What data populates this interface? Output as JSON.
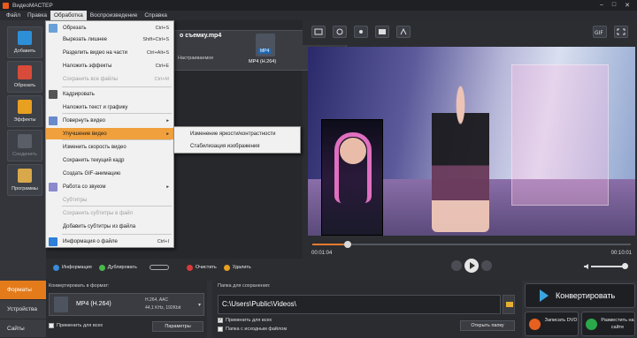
{
  "window": {
    "title": "ВидеоМАСТЕР"
  },
  "menubar": {
    "items": [
      "Файл",
      "Правка",
      "Обработка",
      "Воспроизведение",
      "Справка"
    ],
    "active": "Обработка"
  },
  "left_toolbar": {
    "add": "Добавить",
    "process": "Обрезать",
    "effects": "Эффекты",
    "merge": "Соединить",
    "programs": "Программы"
  },
  "clip": {
    "name": "о съемку.mp4",
    "resolution": "Настраиваемое",
    "format": "MP4 (H.264)",
    "close": "✕"
  },
  "dropdown": {
    "items": [
      {
        "label": "Обрезать",
        "shortcut": "Ctrl+S",
        "disabled": false
      },
      {
        "label": "Вырезать лишнее",
        "shortcut": "Shift+Ctrl+S",
        "disabled": false
      },
      {
        "label": "Разделить видео на части",
        "shortcut": "Ctrl+Alt+S",
        "disabled": false
      },
      {
        "label": "Наложить эффекты",
        "shortcut": "Ctrl+E",
        "disabled": false
      },
      {
        "label": "Сохранить все файлы",
        "shortcut": "Ctrl+M",
        "disabled": true
      },
      {
        "label": "Кадрировать",
        "shortcut": "",
        "disabled": false
      },
      {
        "label": "Наложить текст и графику",
        "shortcut": "",
        "disabled": false
      },
      {
        "label": "Повернуть видео",
        "shortcut": "▸",
        "disabled": false
      },
      {
        "label": "Улучшение видео",
        "shortcut": "▸",
        "disabled": false
      },
      {
        "label": "Изменить скорость видео",
        "shortcut": "",
        "disabled": false
      },
      {
        "label": "Сохранить текущий кадр",
        "shortcut": "",
        "disabled": false
      },
      {
        "label": "Создать GIF-анимацию",
        "shortcut": "",
        "disabled": false
      },
      {
        "label": "Работа со звуком",
        "shortcut": "▸",
        "disabled": false
      },
      {
        "label": "Субтитры",
        "shortcut": "",
        "disabled": true
      },
      {
        "label": "Сохранить субтитры в файл",
        "shortcut": "",
        "disabled": true
      },
      {
        "label": "Добавить субтитры из файла",
        "shortcut": "",
        "disabled": false
      },
      {
        "label": "Информация о файле",
        "shortcut": "Ctrl+I",
        "disabled": false
      }
    ]
  },
  "submenu": {
    "items": [
      "Изменение яркости/контрастности",
      "Стабилизация изображения"
    ]
  },
  "playback": {
    "progress": 0.11,
    "volume": 1.0,
    "current_time": "00:01:04",
    "total_time": "00:10:01"
  },
  "clipbar": {
    "info": "Информация",
    "duplicate": "Дублировать",
    "clear": "Очистить",
    "delete": "Удалить"
  },
  "bottom": {
    "tabs": [
      "Форматы",
      "Устройства",
      "Сайты"
    ],
    "active_tab": "Форматы",
    "format_label": "Конвертировать в формат:",
    "format_name": "MP4 (H.264)",
    "format_detail1": "H.264, AAC",
    "format_detail2": "44,1 KHz, 192Kbit",
    "apply_all": "Применить для всех",
    "params": "Параметры",
    "save_label": "Папка для сохранения:",
    "save_path": "C:\\Users\\Public\\Videos\\",
    "apply_all_save": "Применить для всех",
    "source_folder": "Папка с исходным файлом",
    "open_folder": "Открыть папку",
    "convert": "Конвертировать",
    "burn_dvd": "Записать DVD",
    "publish": "Разместить на сайте"
  },
  "colors": {
    "accent": "#e47b1b",
    "highlight": "#f0a03c",
    "convert_icon": "#3aa6e0"
  }
}
